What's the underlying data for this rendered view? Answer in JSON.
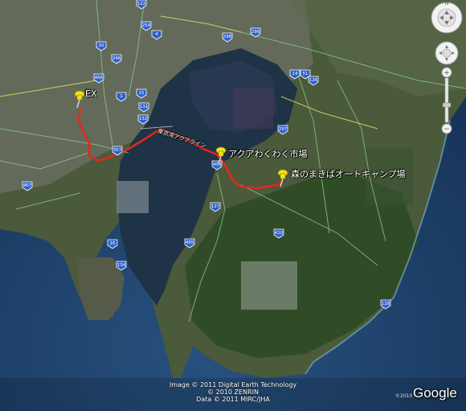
{
  "places": {
    "ex": "EX",
    "aqua_market": "アクアわくわく市場",
    "campground": "森のまきばオートキャンプ場",
    "aqua_line": "東京湾アクアライン"
  },
  "route_shields": [
    "122",
    "254",
    "4",
    "298",
    "296",
    "20",
    "246",
    "466",
    "1",
    "15",
    "131",
    "132",
    "14",
    "51",
    "126",
    "357",
    "409",
    "297",
    "467",
    "127",
    "16",
    "410",
    "134",
    "465",
    "128"
  ],
  "attribution": {
    "line1": "Image © 2011 Digital Earth Technology",
    "line2": "© 2010 ZENRIN",
    "line3": "Data © 2011 MIRC/JHA",
    "year_small": "©2010",
    "logo": "Google"
  },
  "controls": {
    "north": "N",
    "zoom_in": "+",
    "zoom_out": "−"
  },
  "colors": {
    "route": "#e8261c",
    "ocean": "#1b3f6b",
    "bay": "#1e3346",
    "land": "#3d5a2f"
  }
}
